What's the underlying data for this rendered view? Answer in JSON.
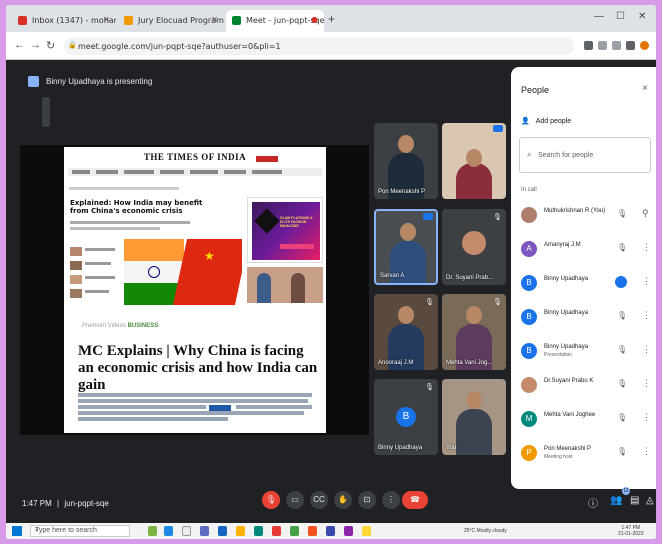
{
  "browser": {
    "tabs": [
      {
        "label": "Inbox (1347) - mohanakrishnan",
        "color": "#d93025"
      },
      {
        "label": "Jury Elocuad Program For Facult",
        "color": "#f29900"
      },
      {
        "label": "Meet - jun-pqpt-sqe",
        "color": "#00832d"
      }
    ],
    "new_tab": "+",
    "url": "meet.google.com/jun-pqpt-sqe?authuser=0&pli=1"
  },
  "meet": {
    "presenting_banner": "Binny Upadhaya is presenting",
    "meeting_time": "1:47 PM",
    "meeting_code": "jun-pqpt-sqe",
    "participant_count": "11"
  },
  "article": {
    "masthead": "THE TIMES OF INDIA",
    "explained_headline": "Explained: How India may benefit from China's economic crisis",
    "section_label": "Premium Videos",
    "section_tag": "BUSINESS",
    "title": "MC Explains | Why China is facing an economic crisis and how India can gain",
    "ad_text": "GLAM PLATINUM & ELITE FASHION MAGAZINE"
  },
  "tiles": [
    {
      "name": "Pon Meenakshi P",
      "muted": false
    },
    {
      "name": "",
      "muted": false
    },
    {
      "name": "Sarvan A",
      "muted": false
    },
    {
      "name": "Dr. Suyani Prab...",
      "muted": true
    },
    {
      "name": "Anooraaj J.M",
      "muted": true
    },
    {
      "name": "Mehta Vani Jog...",
      "muted": true
    },
    {
      "name": "Binny Upadhaya",
      "muted": true,
      "avatar": "B"
    },
    {
      "name": "You",
      "muted": false
    }
  ],
  "people_panel": {
    "title": "People",
    "add_people": "Add people",
    "search_placeholder": "Search for people",
    "in_call_label": "In call",
    "close": "×",
    "participants": [
      {
        "name": "Muthukrishnan R (You)",
        "subtitle": "",
        "initial": "",
        "color": "#b07f6c"
      },
      {
        "name": "Amanyraj J.M",
        "subtitle": "",
        "initial": "A",
        "color": "#7e57c2"
      },
      {
        "name": "Binny Upadhaya",
        "subtitle": "",
        "initial": "B",
        "color": "#1a73e8"
      },
      {
        "name": "Binny Upadhaya",
        "subtitle": "",
        "initial": "B",
        "color": "#1a73e8"
      },
      {
        "name": "Binny Upadhaya",
        "subtitle": "Presentation",
        "initial": "B",
        "color": "#1a73e8"
      },
      {
        "name": "Dr.Suyani Prabu K",
        "subtitle": "",
        "initial": "",
        "color": "#c48a6c"
      },
      {
        "name": "Mehta Vani Joghee",
        "subtitle": "",
        "initial": "M",
        "color": "#00897b"
      },
      {
        "name": "Pon Meenakshi P",
        "subtitle": "Meeting host",
        "initial": "P",
        "color": "#f29900"
      }
    ]
  },
  "taskbar": {
    "search_placeholder": "Type here to search",
    "weather": "25°C Mostly cloudy",
    "time": "1:47 PM",
    "date": "21-01-2023"
  },
  "colors": {
    "accent": "#1a73e8",
    "end_call": "#ea4335",
    "meet_bg": "#202124",
    "outer_bg": "#d79bea"
  }
}
